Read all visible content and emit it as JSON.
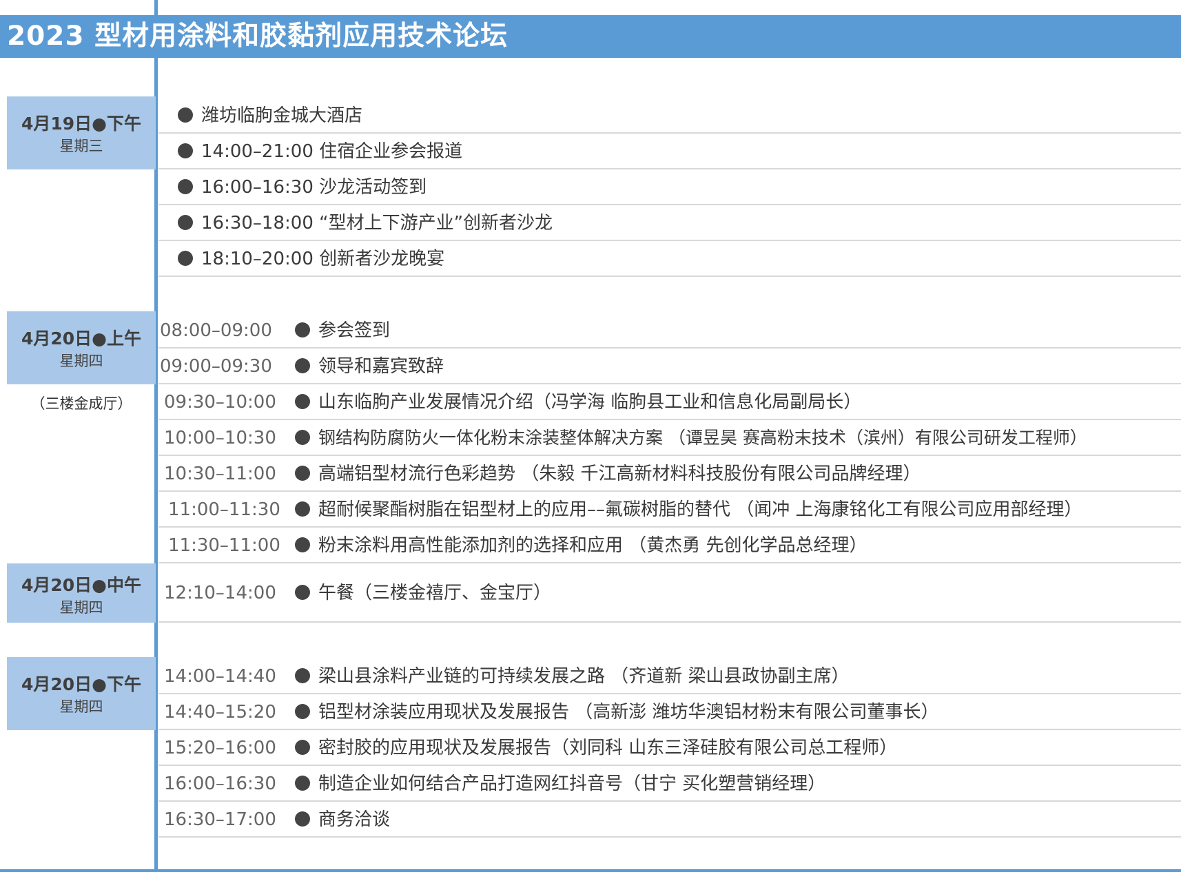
{
  "title": "2023 型材用涂料和胶黏剂应用技术论坛",
  "colors": {
    "accent": "#5b9bd5",
    "date_box": "#a9c8e9"
  },
  "day1": {
    "date": "4月19日●下午",
    "weekday": "星期三",
    "items": [
      "潍坊临朐金城大酒店",
      "14:00–21:00  住宿企业参会报道",
      "16:00–16:30 沙龙活动签到",
      "16:30–18:00 “型材上下游产业”创新者沙龙",
      "18:10–20:00 创新者沙龙晚宴"
    ]
  },
  "day2_am": {
    "date": "4月20日●上午",
    "weekday": "星期四",
    "venue": "（三楼金成厅）",
    "items": [
      {
        "time": "08:00–09:00",
        "text": "参会签到"
      },
      {
        "time": "09:00–09:30",
        "text": "领导和嘉宾致辞"
      },
      {
        "time": "09:30–10:00",
        "text": "山东临朐产业发展情况介绍（冯学海 临朐县工业和信息化局副局长）"
      },
      {
        "time": "10:00–10:30",
        "text": "钢结构防腐防火一体化粉末涂装整体解决方案 （谭昱昊  赛高粉末技术（滨州）有限公司研发工程师）"
      },
      {
        "time": "10:30–11:00",
        "text": "高端铝型材流行色彩趋势 （朱毅  千江高新材料科技股份有限公司品牌经理）"
      },
      {
        "time": "11:00–11:30",
        "text": "超耐候聚酯树脂在铝型材上的应用––氟碳树脂的替代    （闻冲 上海康铭化工有限公司应用部经理）"
      },
      {
        "time": "11:30–11:00",
        "text": "粉末涂料用高性能添加剂的选择和应用 （黄杰勇 先创化学品总经理）"
      }
    ]
  },
  "day2_noon": {
    "date": "4月20日●中午",
    "weekday": "星期四",
    "items": [
      {
        "time": "12:10–14:00",
        "text": "午餐（三楼金禧厅、金宝厅）"
      }
    ]
  },
  "day2_pm": {
    "date": "4月20日●下午",
    "weekday": "星期四",
    "items": [
      {
        "time": "14:00–14:40",
        "text": "梁山县涂料产业链的可持续发展之路   （齐道新 梁山县政协副主席）"
      },
      {
        "time": "14:40–15:20",
        "text": "铝型材涂装应用现状及发展报告  （高新澎 潍坊华澳铝材粉末有限公司董事长）"
      },
      {
        "time": "15:20–16:00",
        "text": "密封胶的应用现状及发展报告（刘同科  山东三泽硅胶有限公司总工程师）"
      },
      {
        "time": "16:00–16:30",
        "text": "制造企业如何结合产品打造网红抖音号（甘宁 买化塑营销经理）"
      },
      {
        "time": "16:30–17:00",
        "text": "商务洽谈"
      }
    ]
  }
}
